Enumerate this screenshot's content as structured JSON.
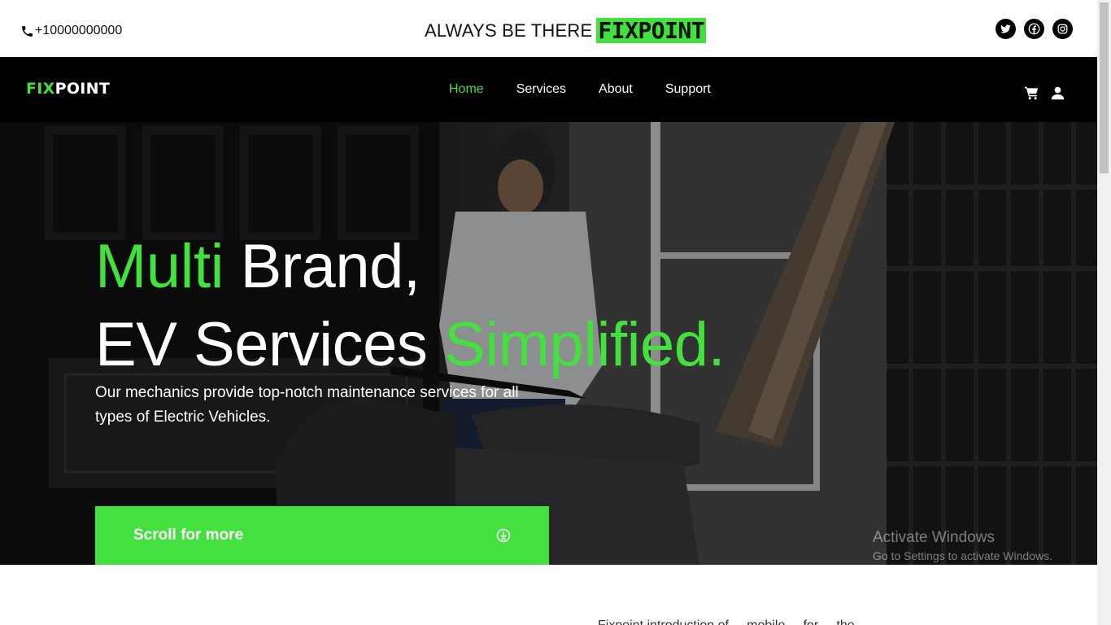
{
  "topbar": {
    "phone": "+10000000000",
    "tagline": "ALWAYS BE THERE",
    "brand": "FIXPOINT"
  },
  "nav": {
    "logo_fix": "FIX",
    "logo_point": "POINT",
    "links": [
      "Home",
      "Services",
      "About",
      "Support"
    ]
  },
  "hero": {
    "line1_green": "Multi",
    "line1_white": " Brand,",
    "line2_white": "EV Services ",
    "line2_green": "Simplified.",
    "subtitle": "Our mechanics provide top-notch maintenance services for all types of Electric Vehicles.",
    "button": "Scroll for more"
  },
  "watermark": {
    "title": "Activate Windows",
    "subtitle": "Go to Settings to activate Windows."
  },
  "below": {
    "text": "Fixpoint introduction of ... mobile ... for ... the"
  },
  "colors": {
    "accent": "#43e03f",
    "nav_bg": "#000000"
  },
  "icons": [
    "phone-icon",
    "twitter-icon",
    "facebook-icon",
    "instagram-icon",
    "cart-icon",
    "user-icon",
    "arrow-down-circle-icon"
  ]
}
